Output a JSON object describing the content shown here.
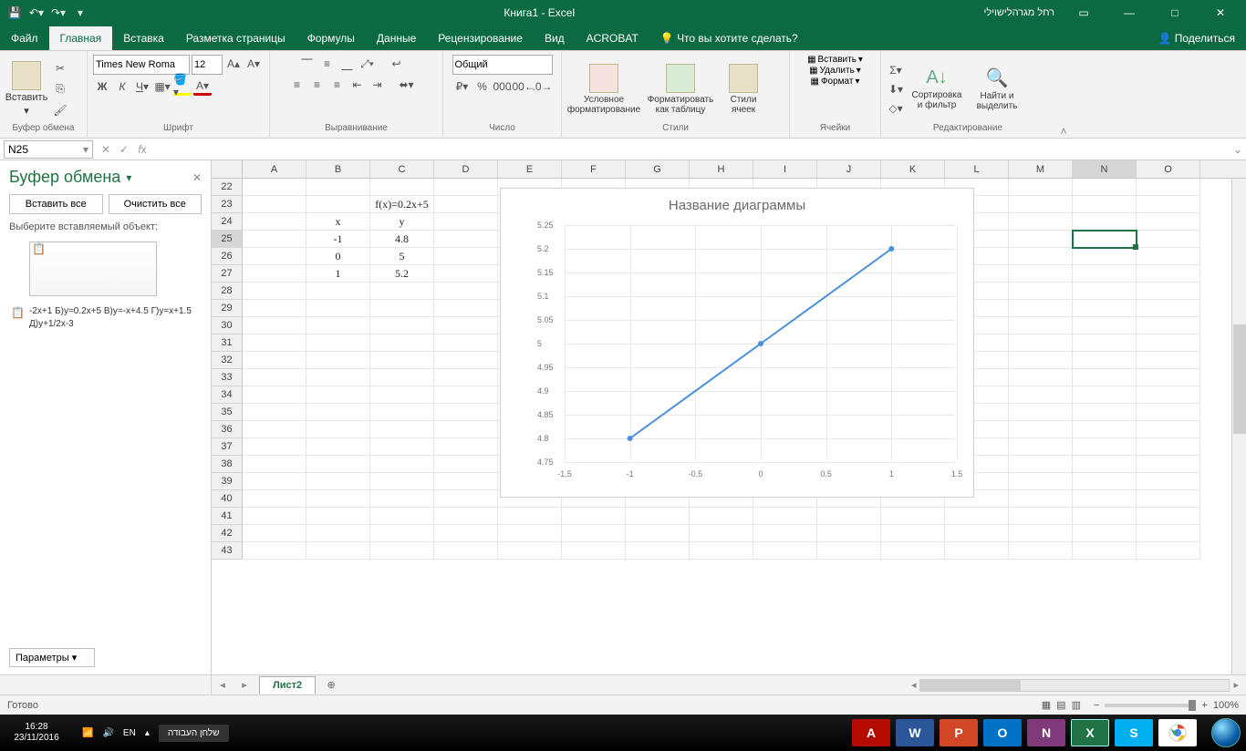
{
  "title": "Книга1  -  Excel",
  "user": "רחל מגרהלישוילי",
  "qat_tips": [
    "save",
    "undo",
    "redo"
  ],
  "tabs": [
    "Файл",
    "Главная",
    "Вставка",
    "Разметка страницы",
    "Формулы",
    "Данные",
    "Рецензирование",
    "Вид",
    "ACROBAT"
  ],
  "active_tab": "Главная",
  "tell_me": "Что вы хотите сделать?",
  "share": "Поделиться",
  "ribbon": {
    "clipboard": {
      "label": "Буфер обмена",
      "paste": "Вставить"
    },
    "font": {
      "label": "Шрифт",
      "name": "Times New Roma",
      "size": "12"
    },
    "align": {
      "label": "Выравнивание"
    },
    "number": {
      "label": "Число",
      "format": "Общий"
    },
    "styles": {
      "label": "Стили",
      "cond": "Условное форматирование",
      "table": "Форматировать как таблицу",
      "cell": "Стили ячеек"
    },
    "cells": {
      "label": "Ячейки",
      "insert": "Вставить",
      "delete": "Удалить",
      "format": "Формат"
    },
    "editing": {
      "label": "Редактирование",
      "sort": "Сортировка и фильтр",
      "find": "Найти и выделить"
    }
  },
  "namebox": "N25",
  "formula": "",
  "sidepane": {
    "title": "Буфер обмена",
    "paste_all": "Вставить все",
    "clear_all": "Очистить все",
    "hint": "Выберите вставляемый объект:",
    "clip2": "-2x+1 Б)y=0.2x+5 В)y=-x+4.5 Г)y=x+1.5 Д)y+1/2x-3",
    "params": "Параметры"
  },
  "columns": [
    "A",
    "B",
    "C",
    "D",
    "E",
    "F",
    "G",
    "H",
    "I",
    "J",
    "K",
    "L",
    "M",
    "N",
    "O"
  ],
  "first_row": 22,
  "last_row": 43,
  "cells": {
    "C23": "f(x)=0.2x+5",
    "B24": "x",
    "C24": "y",
    "B25": "-1",
    "C25": "4.8",
    "B26": "0",
    "C26": "5",
    "B27": "1",
    "C27": "5.2"
  },
  "selected_cell": "N25",
  "chart_data": {
    "type": "line",
    "title": "Название диаграммы",
    "x": [
      -1,
      0,
      1
    ],
    "y": [
      4.8,
      5.0,
      5.2
    ],
    "xlim": [
      -1.5,
      1.5
    ],
    "ylim": [
      4.75,
      5.25
    ],
    "xticks": [
      -1.5,
      -1,
      -0.5,
      0,
      0.5,
      1,
      1.5
    ],
    "yticks": [
      4.75,
      4.8,
      4.85,
      4.9,
      4.95,
      5,
      5.05,
      5.1,
      5.15,
      5.2,
      5.25
    ]
  },
  "sheet": "Лист2",
  "status": "Готово",
  "zoom": "100%",
  "clock": {
    "time": "16:28",
    "date": "23/11/2016"
  },
  "lang": "EN",
  "task_lbl": "שלחן העבודה"
}
